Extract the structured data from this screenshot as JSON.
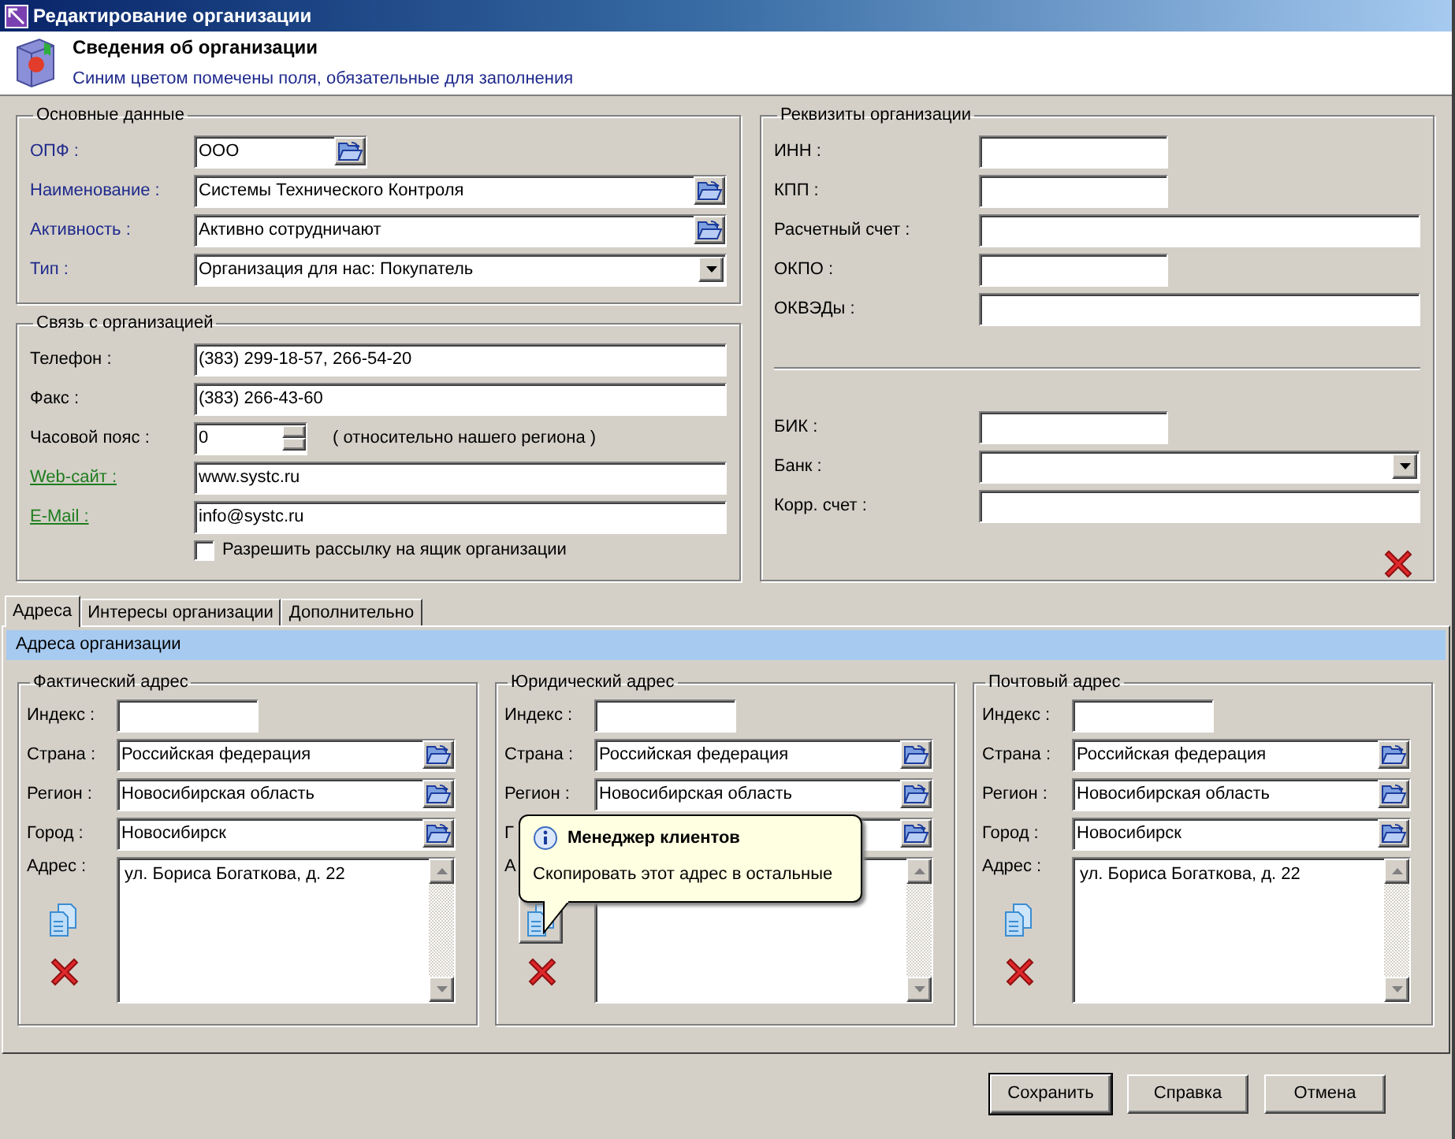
{
  "window": {
    "title": "Редактирование организации"
  },
  "header": {
    "title": "Сведения об организации",
    "subtitle": "Синим цветом помечены поля, обязательные для заполнения"
  },
  "main": {
    "title": "Основные данные",
    "fields": [
      {
        "label": "ОПФ :",
        "required": true,
        "link": false,
        "kind": "short_lookup",
        "value": "ООО"
      },
      {
        "label": "Наименование :",
        "required": true,
        "link": false,
        "kind": "lookup",
        "value": "Системы Технического Контроля"
      },
      {
        "label": "Активность :",
        "required": true,
        "link": false,
        "kind": "lookup",
        "value": "Активно сотрудничают"
      },
      {
        "label": "Тип :",
        "required": true,
        "link": false,
        "kind": "select",
        "value": "Организация для нас: Покупатель"
      }
    ]
  },
  "contact": {
    "title": "Связь с организацией",
    "fields": [
      {
        "label": "Телефон :",
        "required": false,
        "link": false,
        "kind": "text",
        "value": "(383) 299-18-57, 266-54-20"
      },
      {
        "label": "Факс :",
        "required": false,
        "link": false,
        "kind": "text",
        "value": "(383) 266-43-60"
      },
      {
        "label": "Часовой пояс :",
        "required": false,
        "link": false,
        "kind": "spin",
        "value": "0",
        "note": "( относительно нашего региона )"
      },
      {
        "label": "Web-сайт :",
        "required": false,
        "link": true,
        "kind": "text",
        "value": "www.systc.ru"
      },
      {
        "label": "E-Mail :",
        "required": false,
        "link": true,
        "kind": "text",
        "value": "info@systc.ru"
      }
    ],
    "checkbox": {
      "label": "Разрешить рассылку на ящик организации",
      "checked": false
    }
  },
  "requisites": {
    "title": "Реквизиты организации",
    "fields": [
      {
        "label": "ИНН :",
        "kind": "short"
      },
      {
        "label": "КПП :",
        "kind": "short"
      },
      {
        "label": "Расчетный счет :",
        "kind": "text"
      },
      {
        "label": "ОКПО :",
        "kind": "short"
      },
      {
        "label": "ОКВЭДы :",
        "kind": "text"
      }
    ],
    "bank_fields": [
      {
        "label": "БИК :",
        "kind": "short"
      },
      {
        "label": "Банк :",
        "kind": "select"
      },
      {
        "label": "Корр. счет :",
        "kind": "text"
      }
    ]
  },
  "tabs": [
    {
      "label": "Адреса",
      "selected": true
    },
    {
      "label": "Интересы организации",
      "selected": false
    },
    {
      "label": "Дополнительно",
      "selected": false
    }
  ],
  "panel": {
    "title": "Адреса организации",
    "groups": [
      {
        "title": "Фактический адрес",
        "hovered": false,
        "fields": [
          {
            "label": "Индекс :",
            "kind": "short"
          },
          {
            "label": "Страна :",
            "kind": "lookup",
            "value": "Российская федерация"
          },
          {
            "label": "Регион :",
            "kind": "lookup",
            "value": "Новосибирская область"
          },
          {
            "label": "Город :",
            "kind": "lookup",
            "value": "Новосибирск"
          }
        ],
        "address_label": "Адрес :",
        "address": "ул. Бориса Богаткова, д. 22"
      },
      {
        "title": "Юридический адрес",
        "hovered": true,
        "fields": [
          {
            "label": "Индекс :",
            "kind": "short"
          },
          {
            "label": "Страна :",
            "kind": "lookup",
            "value": "Российская федерация"
          },
          {
            "label": "Регион :",
            "kind": "lookup",
            "value": "Новосибирская область"
          },
          {
            "label": "Г",
            "kind": "lookup"
          }
        ],
        "address_label": "А"
      },
      {
        "title": "Почтовый адрес",
        "hovered": false,
        "fields": [
          {
            "label": "Индекс :",
            "kind": "short"
          },
          {
            "label": "Страна :",
            "kind": "lookup",
            "value": "Российская федерация"
          },
          {
            "label": "Регион :",
            "kind": "lookup",
            "value": "Новосибирская область"
          },
          {
            "label": "Город :",
            "kind": "lookup",
            "value": "Новосибирск"
          }
        ],
        "address_label": "Адрес :",
        "address": "ул. Бориса Богаткова, д. 22"
      }
    ]
  },
  "tooltip": {
    "title": "Менеджер клиентов",
    "text": "Скопировать этот адрес в остальные"
  },
  "buttons": [
    {
      "label": "Сохранить",
      "default": true
    },
    {
      "label": "Справка",
      "default": false
    },
    {
      "label": "Отмена",
      "default": false
    }
  ]
}
